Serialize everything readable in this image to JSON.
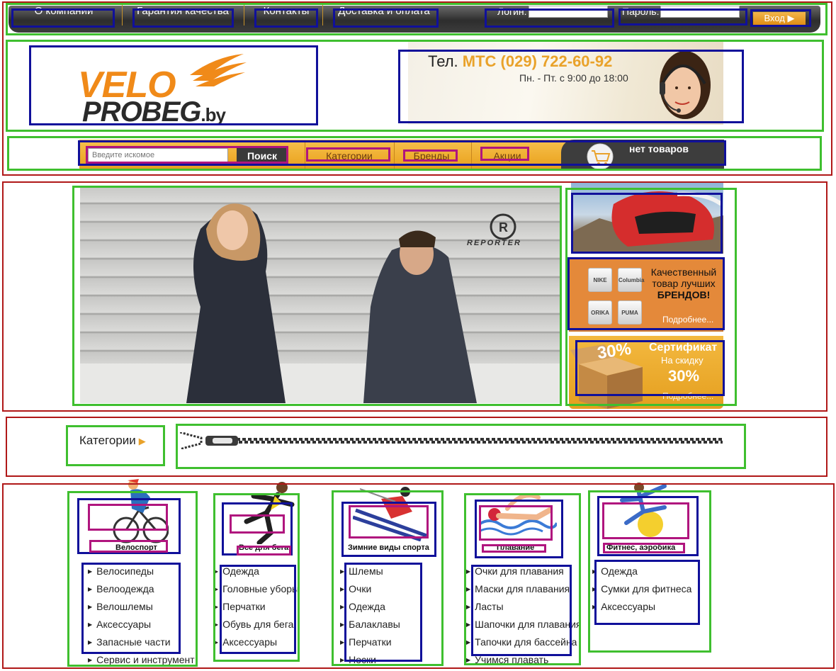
{
  "topnav": {
    "items": [
      "О компании",
      "Гарантия качества",
      "Контакты",
      "Доставка и оплата"
    ],
    "login_label": "Логин:",
    "password_label": "Пароль:",
    "enter_label": "Вход ▶"
  },
  "header": {
    "logo_line1": "VELO",
    "logo_line2": "PROBEG",
    "logo_suffix": ".by",
    "phone_prefix": "Тел.",
    "phone_number": "МТС (029) 722-60-92",
    "hours": "Пн. - Пт. с 9:00 до 18:00"
  },
  "searchbar": {
    "placeholder": "Введите искомое",
    "search_label": "Поиск",
    "links": [
      "Категории",
      "Бренды",
      "Акции"
    ],
    "cart_text": "нет товаров"
  },
  "banners": {
    "main_brand": "REPORTER",
    "brands_text_1": "Качественный",
    "brands_text_2": "товар лучших",
    "brands_text_3": "БРЕНДОВ!",
    "brands_more": "Подробнее...",
    "brand_logos": [
      "NIKE",
      "Columbia",
      "ORIKA",
      "PUMA"
    ],
    "cert_badge": "30%",
    "cert_title": "Сертификат",
    "cert_sub": "На скидку",
    "cert_pct": "30%",
    "cert_more": "Подробнее..."
  },
  "categories": {
    "label": "Категории",
    "arrow": "▶",
    "columns": [
      {
        "title": "Велоспорт",
        "items": [
          "Велосипеды",
          "Велоодежда",
          "Велошлемы",
          "Аксессуары",
          "Запасные части",
          "Сервис и инструмент"
        ]
      },
      {
        "title": "Все для бега",
        "items": [
          "Одежда",
          "Головные уборы",
          "Перчатки",
          "Обувь для бега",
          "Аксессуары"
        ]
      },
      {
        "title": "Зимние виды спорта",
        "items": [
          "Шлемы",
          "Очки",
          "Одежда",
          "Балаклавы",
          "Перчатки",
          "Носки"
        ]
      },
      {
        "title": "Плавание",
        "items": [
          "Очки для плавания",
          "Маски для плавания",
          "Ласты",
          "Шапочки для плавания",
          "Тапочки для бассейна",
          "Учимся плавать"
        ]
      },
      {
        "title": "Фитнес, аэробика",
        "items": [
          "Одежда",
          "Сумки для фитнеса",
          "Аксессуары"
        ]
      }
    ]
  },
  "colors": {
    "accent_orange": "#e9a22a",
    "nav_dark": "#2d2d2d",
    "annotation_red": "#b01818",
    "annotation_green": "#3fbf2f",
    "annotation_blue": "#10109a",
    "annotation_pink": "#b0157e"
  }
}
